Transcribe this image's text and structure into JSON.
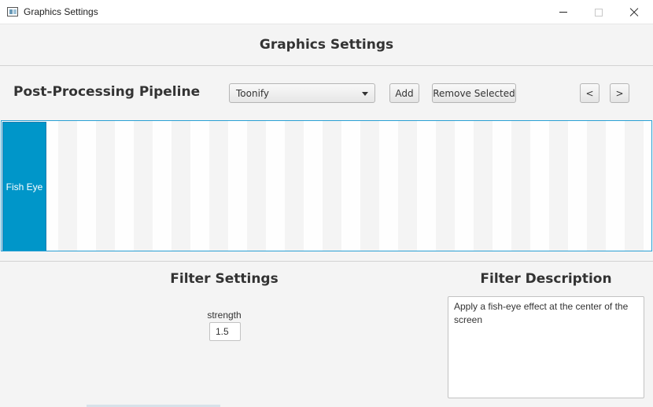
{
  "window": {
    "title": "Graphics Settings"
  },
  "header": {
    "title": "Graphics Settings"
  },
  "pipeline": {
    "label": "Post-Processing Pipeline",
    "filter_select": {
      "selected": "Toonify"
    },
    "add_label": "Add",
    "remove_label": "Remove Selected",
    "prev_label": "<",
    "next_label": ">",
    "items": [
      {
        "label": "Fish Eye",
        "selected": true
      }
    ]
  },
  "filter_settings": {
    "title": "Filter Settings",
    "params": [
      {
        "label": "strength",
        "value": "1.5"
      }
    ]
  },
  "filter_description": {
    "title": "Filter Description",
    "text": "Apply a fish-eye effect at the center of the screen"
  },
  "colors": {
    "accent": "#0096c9",
    "strip_border": "#2aa0d4",
    "background": "#f4f4f4"
  }
}
